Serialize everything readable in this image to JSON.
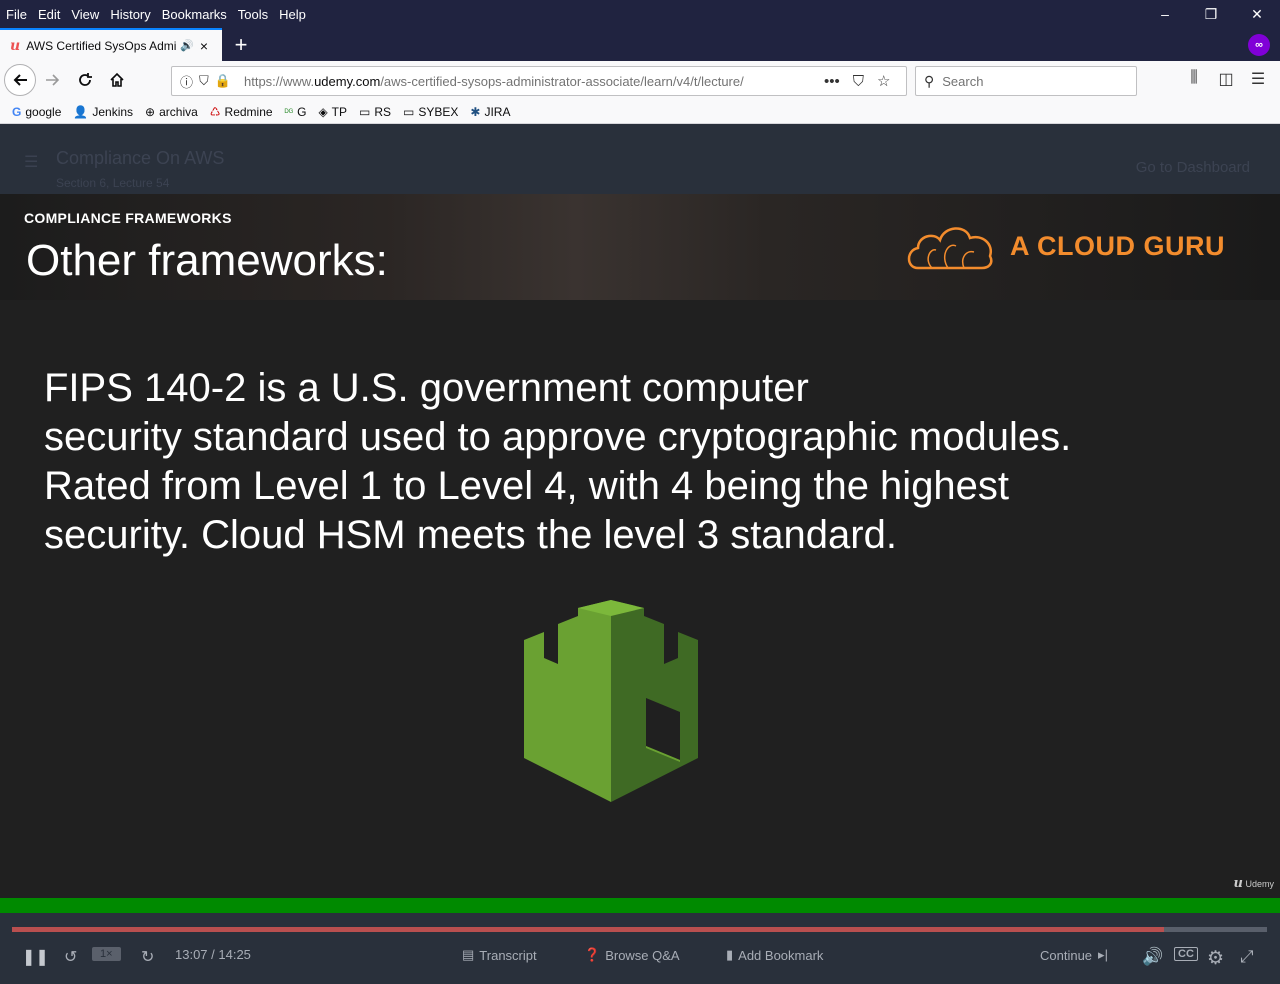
{
  "menu": [
    "File",
    "Edit",
    "View",
    "History",
    "Bookmarks",
    "Tools",
    "Help"
  ],
  "tab": {
    "title": "AWS Certified SysOps Admin",
    "favicon": "u",
    "audio_icon": "speaker-icon",
    "close": "×"
  },
  "newtab": "+",
  "urlbar": {
    "prefix": "https://www.",
    "domain": "udemy.com",
    "path": "/aws-certified-sysops-administrator-associate/learn/v4/t/lecture/",
    "more": "•••"
  },
  "search": {
    "placeholder": "Search"
  },
  "bookmarks": [
    {
      "icon": "G",
      "label": "google"
    },
    {
      "icon": "👤",
      "label": "Jenkins"
    },
    {
      "icon": "⊕",
      "label": "archiva"
    },
    {
      "icon": "♺",
      "label": "Redmine"
    },
    {
      "icon": "ᴰᴳ",
      "label": "G"
    },
    {
      "icon": "◈",
      "label": "TP"
    },
    {
      "icon": "▭",
      "label": "RS"
    },
    {
      "icon": "▭",
      "label": "SYBEX"
    },
    {
      "icon": "✱",
      "label": "JIRA"
    }
  ],
  "udemy_header": {
    "course_title": "Compliance On AWS",
    "lecture": "Section 6, Lecture 54",
    "dashboard": "Go to Dashboard"
  },
  "slide": {
    "kicker": "COMPLIANCE FRAMEWORKS",
    "title": "Other frameworks:",
    "brand": "A CLOUD GURU",
    "lines": [
      "FIPS 140-2 is a U.S. government computer",
      "security standard used to approve cryptographic modules.",
      "Rated from Level 1 to Level 4, with 4 being the highest",
      "security. Cloud HSM meets the level 3 standard."
    ],
    "watermark": "Udemy"
  },
  "player": {
    "progress": 0.918,
    "speed": "1×",
    "time": "13:07 / 14:25",
    "transcript": "Transcript",
    "qa": "Browse Q&A",
    "bookmark": "Add Bookmark",
    "continue": "Continue"
  }
}
